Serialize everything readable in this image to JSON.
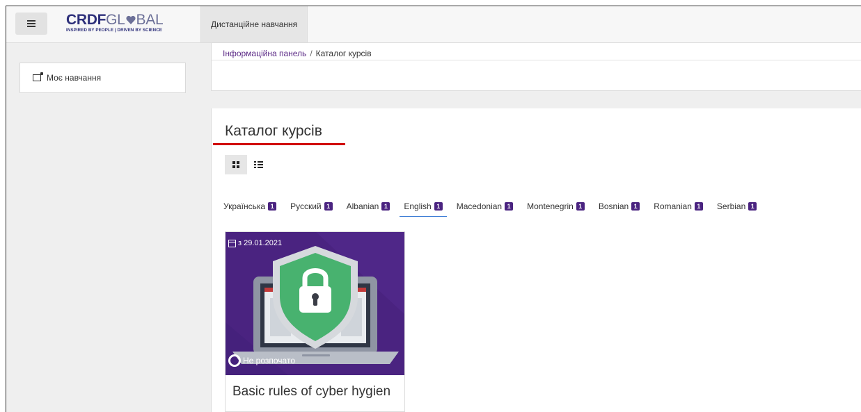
{
  "navbar": {
    "logo_main_a": "CRDF",
    "logo_main_b": "GL",
    "logo_main_c": "BAL",
    "logo_tagline": "INSPIRED BY PEOPLE | DRIVEN BY SCIENCE",
    "nav_tab": "Дистанційне навчання"
  },
  "sidebar": {
    "my_learning": "Моє навчання"
  },
  "breadcrumb": {
    "home": "Інформаційна панель",
    "separator": "/",
    "current": "Каталог курсів"
  },
  "page": {
    "title": "Каталог курсів"
  },
  "colors": {
    "accent": "#4a2380",
    "underline": "#d00000",
    "active_tab": "#3a7bd5"
  },
  "languages": [
    {
      "label": "Українська",
      "count": "1"
    },
    {
      "label": "Русский",
      "count": "1"
    },
    {
      "label": "Albanian",
      "count": "1"
    },
    {
      "label": "English",
      "count": "1"
    },
    {
      "label": "Macedonian",
      "count": "1"
    },
    {
      "label": "Montenegrin",
      "count": "1"
    },
    {
      "label": "Bosnian",
      "count": "1"
    },
    {
      "label": "Romanian",
      "count": "1"
    },
    {
      "label": "Serbian",
      "count": "1"
    }
  ],
  "active_language": "English",
  "course": {
    "date": "з 29.01.2021",
    "status": "Не розпочато",
    "title": "Basic rules of cyber hygien"
  }
}
